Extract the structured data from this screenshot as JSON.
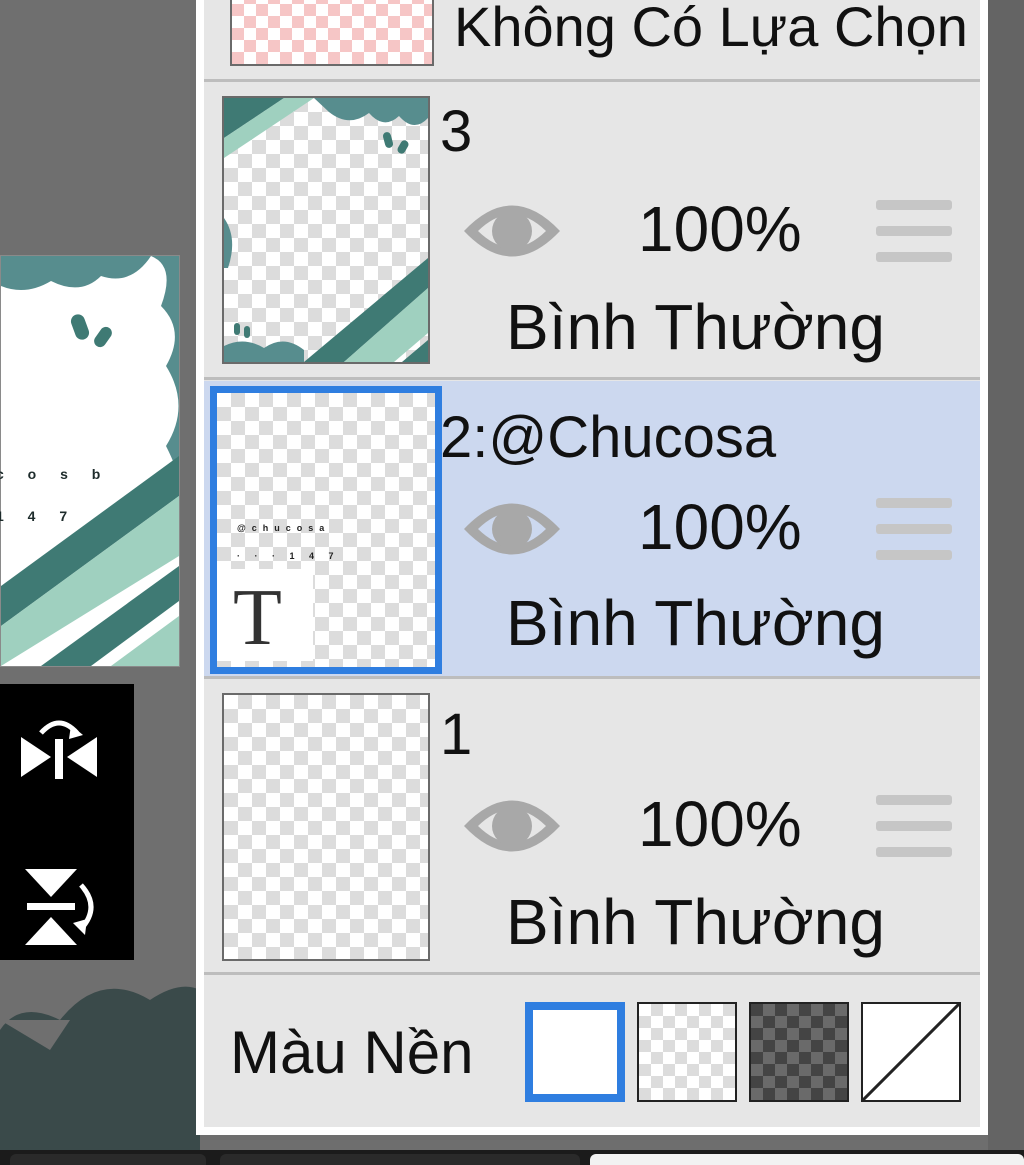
{
  "selection_row": {
    "label": "Không Có Lựa Chọn"
  },
  "layers": [
    {
      "name": "3",
      "opacity": "100%",
      "blend_mode": "Bình Thường",
      "visible_icon": "eye-icon",
      "selected": false
    },
    {
      "name": "2:@Chucosa",
      "opacity": "100%",
      "blend_mode": "Bình Thường",
      "visible_icon": "eye-icon",
      "selected": true,
      "type_glyph": "T"
    },
    {
      "name": "1",
      "opacity": "100%",
      "blend_mode": "Bình Thường",
      "visible_icon": "eye-icon",
      "selected": false
    }
  ],
  "background_color": {
    "label": "Màu Nền",
    "options": [
      "white",
      "light-checker",
      "dark-checker",
      "none"
    ],
    "selected": "white"
  },
  "canvas_preview": {
    "text_line_1": "c o s b",
    "text_line_2": "1 4 7"
  },
  "toolbar": {
    "flip_horizontal_icon": "flip-horizontal-icon",
    "flip_vertical_icon": "flip-vertical-icon"
  },
  "colors": {
    "accent": "#2f7ee0",
    "selected_row": "#ccd8ef",
    "teal_dark": "#3f7a74",
    "teal_light": "#9fd0bf",
    "cloud": "#578d8e"
  }
}
